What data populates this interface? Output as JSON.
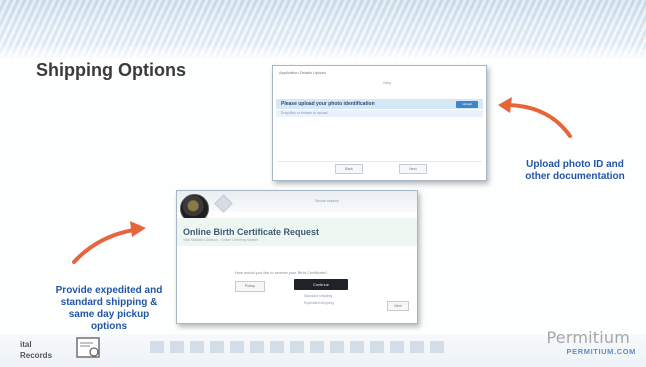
{
  "slide": {
    "title": "Shipping Options",
    "caption_right_line1": "Upload photo ID and",
    "caption_right_line2": "other documentation",
    "caption_left_line1": "Provide expedited and",
    "caption_left_line2": "standard shipping &",
    "caption_left_line3": "same day pickup",
    "caption_left_line4": "options"
  },
  "screenshot_top": {
    "header": "Application Details Upload",
    "subheader": "Step",
    "bar_text": "Please upload your photo identification",
    "upload_button": "Upload",
    "strip_text": "Drag files or browse to upload",
    "button_left": "Back",
    "button_right": "Next"
  },
  "screenshot_bottom": {
    "title": "Online Birth Certificate Request",
    "subtitle": "Vital Statistics Division - Online Ordering System",
    "question": "How would you like to receive your Birth Certificate?",
    "button_prev": "Pickup",
    "button_continue": "Continue",
    "small_line1": "Standard shipping",
    "small_line2": "Expedited shipping",
    "button_next": "Next",
    "status_text": "Secure session"
  },
  "logo_left": {
    "line1": "ital",
    "line2": "Records"
  },
  "brand": {
    "name": "Permitium",
    "url": "PERMITIUM.COM"
  },
  "colors": {
    "caption": "#2255a8",
    "arrow": "#e8643a",
    "brand_gray": "#a4a6aa",
    "brand_blue": "#5b8fc9"
  }
}
